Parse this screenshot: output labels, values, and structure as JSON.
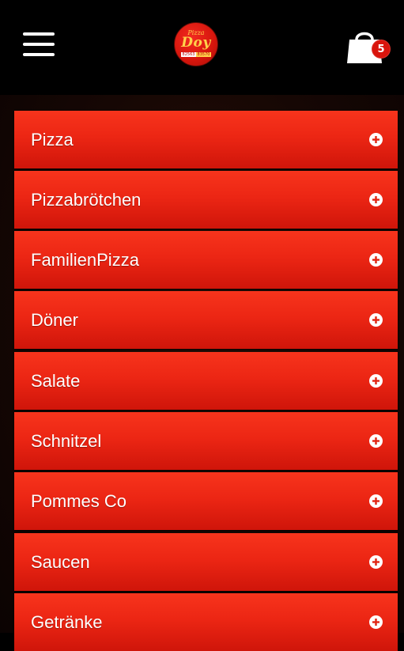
{
  "header": {
    "menu_icon": "hamburger-menu-icon",
    "logo": {
      "small_text": "Pizza",
      "main_text": "Doy",
      "bar_left": "82563",
      "bar_right": "83570"
    },
    "cart": {
      "icon": "shopping-bag-icon",
      "count": "5"
    }
  },
  "menu": {
    "expand_icon": "plus-circle-icon",
    "items": [
      {
        "label": "Pizza"
      },
      {
        "label": "Pizzabrötchen"
      },
      {
        "label": "FamilienPizza"
      },
      {
        "label": "Döner"
      },
      {
        "label": "Salate"
      },
      {
        "label": "Schnitzel"
      },
      {
        "label": "Pommes Co"
      },
      {
        "label": "Saucen"
      },
      {
        "label": "Getränke"
      }
    ]
  },
  "colors": {
    "header_bg": "#000000",
    "item_red": "#ec2614",
    "badge_red": "#d9140c",
    "logo_gold": "#ffd24a"
  }
}
